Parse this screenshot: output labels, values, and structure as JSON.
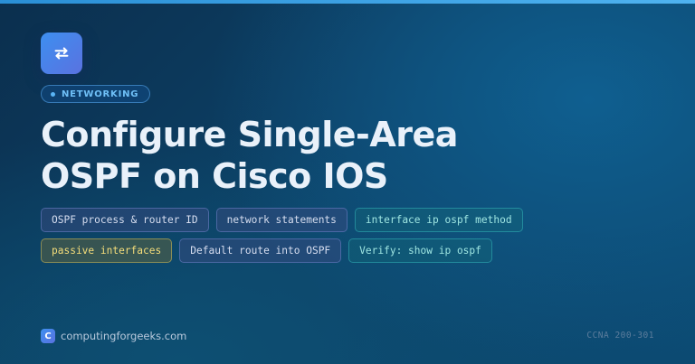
{
  "category": "NETWORKING",
  "title_line1": "Configure Single-Area",
  "title_line2": "OSPF on Cisco IOS",
  "logo_icon": "swap-arrows-icon",
  "tags": [
    {
      "label": "OSPF process & router ID",
      "color": "blue"
    },
    {
      "label": "network statements",
      "color": "blue"
    },
    {
      "label": "interface ip ospf method",
      "color": "cyan"
    },
    {
      "label": "passive interfaces",
      "color": "yellow"
    },
    {
      "label": "Default route into OSPF",
      "color": "blue"
    },
    {
      "label": "Verify: show ip ospf",
      "color": "cyan"
    }
  ],
  "footer": {
    "logo_letter": "C",
    "site": "computingforgeeks.com",
    "exam": "CCNA 200-301"
  },
  "colors": {
    "accent": "#4fb3f0",
    "title": "#e9f1fa",
    "highlight_tag": "#f5dd7a"
  }
}
